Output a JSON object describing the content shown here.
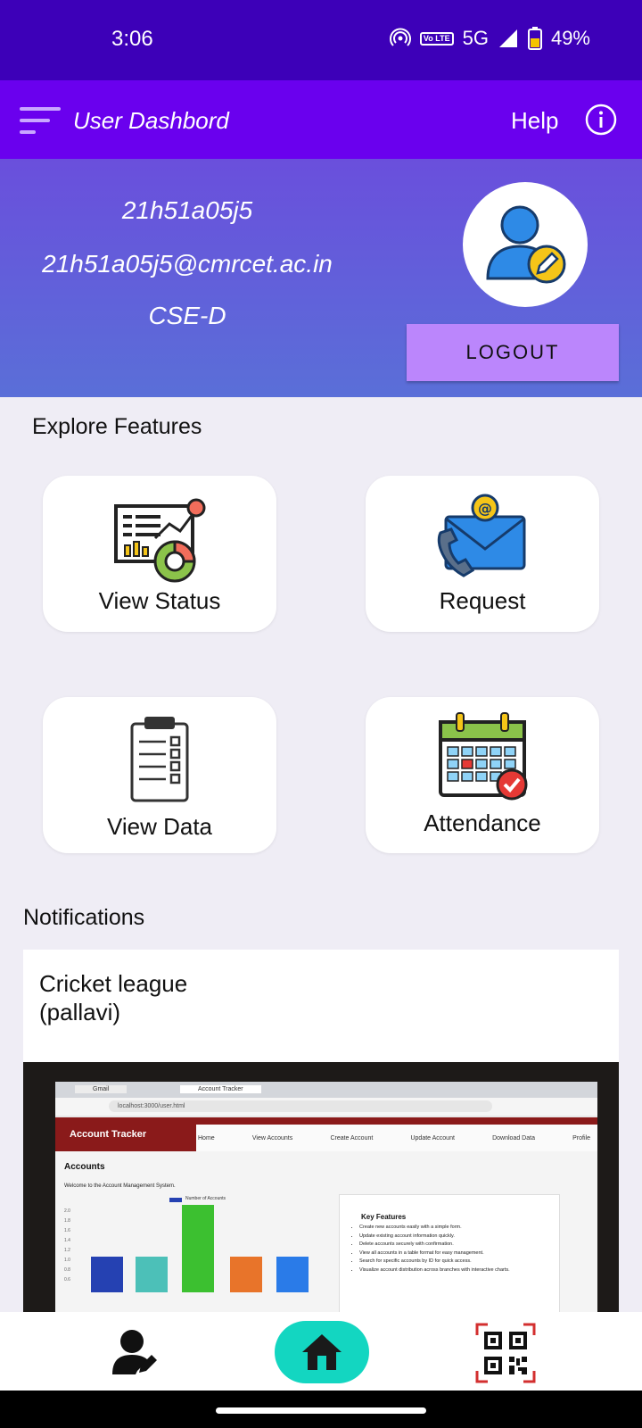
{
  "status_bar": {
    "time": "3:06",
    "network": "5G",
    "volte": "Vo LTE",
    "battery": "49%"
  },
  "app_bar": {
    "title": "User Dashbord",
    "help_label": "Help"
  },
  "profile": {
    "username": "21h51a05j5",
    "email": "21h51a05j5@cmrcet.ac.in",
    "section": "CSE-D",
    "logout_label": "LOGOUT"
  },
  "features": {
    "heading": "Explore Features",
    "items": [
      {
        "label": "View Status",
        "icon": "analytics-chart-icon"
      },
      {
        "label": "Request",
        "icon": "phone-mail-icon"
      },
      {
        "label": "View Data",
        "icon": "clipboard-checklist-icon"
      },
      {
        "label": "Attendance",
        "icon": "calendar-check-icon"
      }
    ]
  },
  "notifications": {
    "heading": "Notifications",
    "items": [
      {
        "title_line1": "Cricket league",
        "title_line2": "(pallavi)",
        "image": {
          "tabs": [
            "Gmail",
            "Account Tracker"
          ],
          "url": "localhost:3000/user.html",
          "app_name": "Account Tracker",
          "nav": [
            "Home",
            "View Accounts",
            "Create Account",
            "Update Account",
            "Download Data",
            "Profile"
          ],
          "page_title": "Accounts",
          "welcome": "Welcome to the Account Management System.",
          "legend": "Number of Accounts",
          "key_features_title": "Key Features",
          "key_features": [
            "Create new accounts easily with a simple form.",
            "Update existing account information quickly.",
            "Delete accounts securely with confirmation.",
            "View all accounts in a table format for easy management.",
            "Search for specific accounts by ID for quick access.",
            "Visualize account distribution across branches with interactive charts."
          ],
          "y_ticks": [
            "2.0",
            "1.8",
            "1.6",
            "1.4",
            "1.2",
            "1.0",
            "0.8",
            "0.6"
          ]
        }
      }
    ]
  },
  "bottom_nav": {
    "items": [
      "profile-edit-icon",
      "home-icon",
      "qr-code-icon"
    ],
    "accent": "#13d6c1"
  },
  "colors": {
    "status_bar": "#3d00b8",
    "app_bar": "#6a00ee",
    "logout_button": "#bb86fc"
  }
}
